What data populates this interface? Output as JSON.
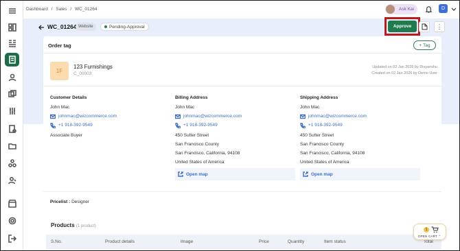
{
  "breadcrumb": [
    "Dashboard",
    "/",
    "Sales",
    "/",
    "WC_01264"
  ],
  "header": {
    "ask_kai": "Ask Kai",
    "user_initial": "D"
  },
  "order": {
    "id": "WC_01264",
    "channel": "Website",
    "status": "Pending-Approval",
    "approve_label": "Approve"
  },
  "order_tag": {
    "title": "Order tag",
    "tag_button": "Tag"
  },
  "customer": {
    "logo_text": "1F",
    "name": "123 Furnishings",
    "code": "C_00003",
    "updated": "Updated on 02 Jan 2026 by Divyanshu",
    "created": "Created on 02 Jan 2026 by Demo User"
  },
  "customer_details": {
    "title": "Customer Details",
    "name": "John Mac",
    "email": "johnmac@wizcommerce.com",
    "phone": "+1 918-392-9549",
    "role": "Associate Buyer"
  },
  "billing": {
    "title": "Billing Address",
    "name": "John Mac",
    "email": "johnmac@wizcommerce.com",
    "phone": "+1 918-392-9549",
    "line1": "450 Sutter Street",
    "line2": "San Francisco County",
    "line3": "San Francisco, California, 94108",
    "line4": "United States of America",
    "map": "Open map"
  },
  "shipping": {
    "title": "Shipping Address",
    "name": "John Mac",
    "email": "johnmac@wizcommerce.com",
    "phone": "+1 918-392-9549",
    "line1": "450 Sutter Street",
    "line2": "San Francisco County",
    "line3": "San Francisco, California, 94108",
    "line4": "United States of America",
    "map": "Open map"
  },
  "pricelist": {
    "label": "Pricelist :",
    "value": "Designer"
  },
  "products": {
    "title": "Products",
    "count": "(1 product)",
    "columns": [
      "S.No.",
      "Product details",
      "Image",
      "Price",
      "Quantity",
      "Item status",
      "Total"
    ]
  },
  "cart": {
    "count": "1",
    "label": "OPEN CART"
  },
  "colors": {
    "brand_green": "#1f7a4d",
    "highlight_red": "#b81d1d",
    "band_blue": "#e8eefb"
  }
}
